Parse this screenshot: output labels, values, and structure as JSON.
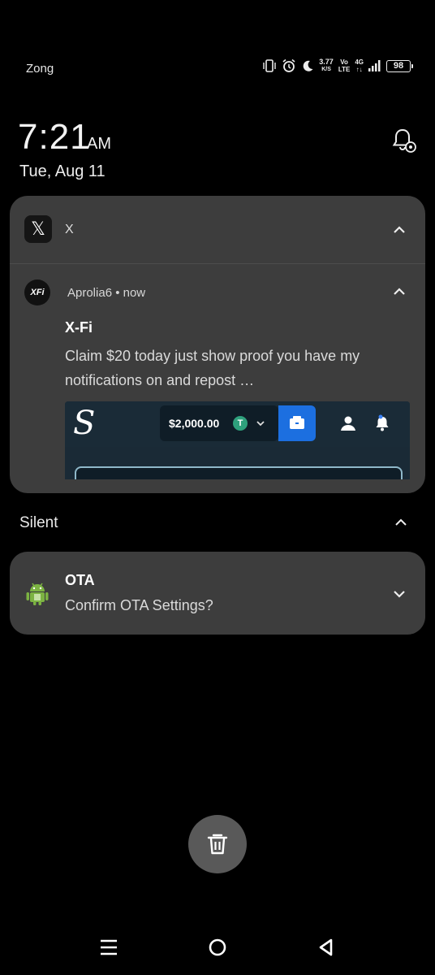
{
  "status_bar": {
    "carrier": "Zong",
    "speed_value": "3.77",
    "speed_unit": "K/S",
    "volte_top": "Vo",
    "volte_bottom": "LTE",
    "network_top": "4G",
    "network_bottom": "↑↓",
    "battery": "98"
  },
  "lockscreen": {
    "time": "7:21",
    "ampm": "AM",
    "date": "Tue, Aug 11"
  },
  "notifications": {
    "x_group": {
      "app_name": "X",
      "sender": "Aprolia6 • now",
      "title": "X-Fi",
      "body": "Claim $20 today just show proof you have my notifications on and repost …",
      "preview": {
        "balance": "$2,000.00",
        "coin": "T"
      }
    },
    "silent_section_label": "Silent",
    "ota": {
      "title": "OTA",
      "body": "Confirm OTA Settings?"
    }
  },
  "icons": {
    "x_logo_glyph": "𝕏",
    "xfi_avatar_text": "XFi"
  }
}
